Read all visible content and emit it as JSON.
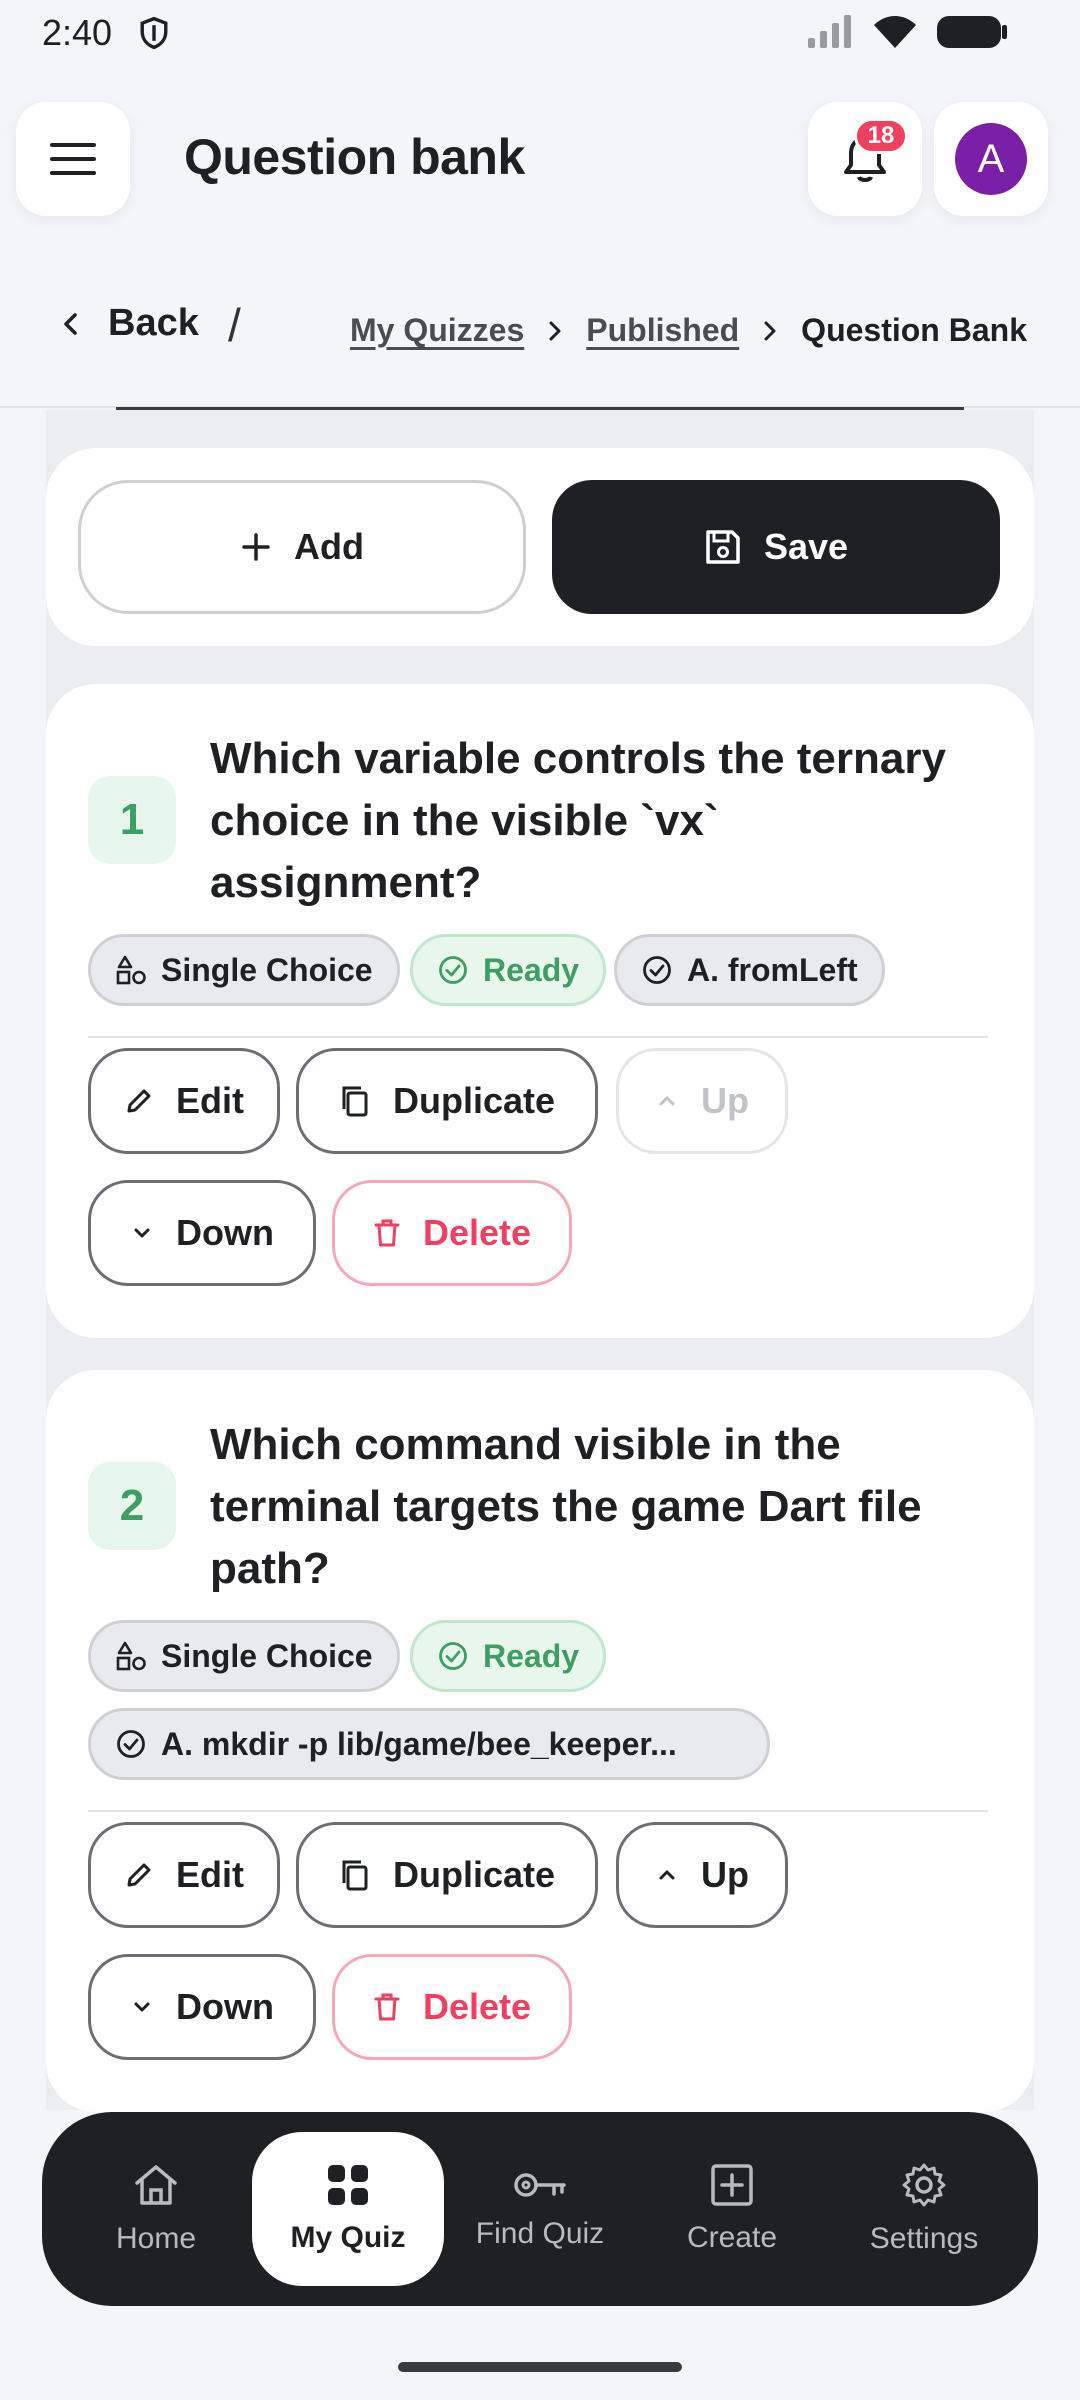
{
  "status": {
    "time": "2:40"
  },
  "header": {
    "title": "Question bank",
    "notification_count": "18",
    "avatar_initial": "A"
  },
  "breadcrumb": {
    "back_label": "Back",
    "separator": "/",
    "items": [
      "My Quizzes",
      "Published",
      "Question Bank"
    ]
  },
  "actions": {
    "add_label": "Add",
    "save_label": "Save"
  },
  "questions": [
    {
      "number": "1",
      "text": "Which variable controls the ternary choice in the visible `vx` assignment?",
      "type": "Single Choice",
      "status": "Ready",
      "answer": "A. fromLeft",
      "buttons": {
        "edit": "Edit",
        "duplicate": "Duplicate",
        "up": "Up",
        "down": "Down",
        "delete": "Delete"
      }
    },
    {
      "number": "2",
      "text": "Which command visible in the terminal targets the game Dart file path?",
      "type": "Single Choice",
      "status": "Ready",
      "answer": "A. mkdir -p lib/game/bee_keeper...",
      "buttons": {
        "edit": "Edit",
        "duplicate": "Duplicate",
        "up": "Up",
        "down": "Down",
        "delete": "Delete"
      }
    }
  ],
  "nav": {
    "items": [
      {
        "label": "Home",
        "icon": "home-icon"
      },
      {
        "label": "My Quiz",
        "icon": "grid-icon"
      },
      {
        "label": "Find Quiz",
        "icon": "key-icon"
      },
      {
        "label": "Create",
        "icon": "plus-square-icon"
      },
      {
        "label": "Settings",
        "icon": "gear-icon"
      }
    ],
    "active": "My Quiz"
  },
  "colors": {
    "accent_green": "#3f9e65",
    "danger": "#ef3f63",
    "dark": "#1f2024",
    "avatar": "#7a1fa8",
    "badge": "#f0405f"
  }
}
